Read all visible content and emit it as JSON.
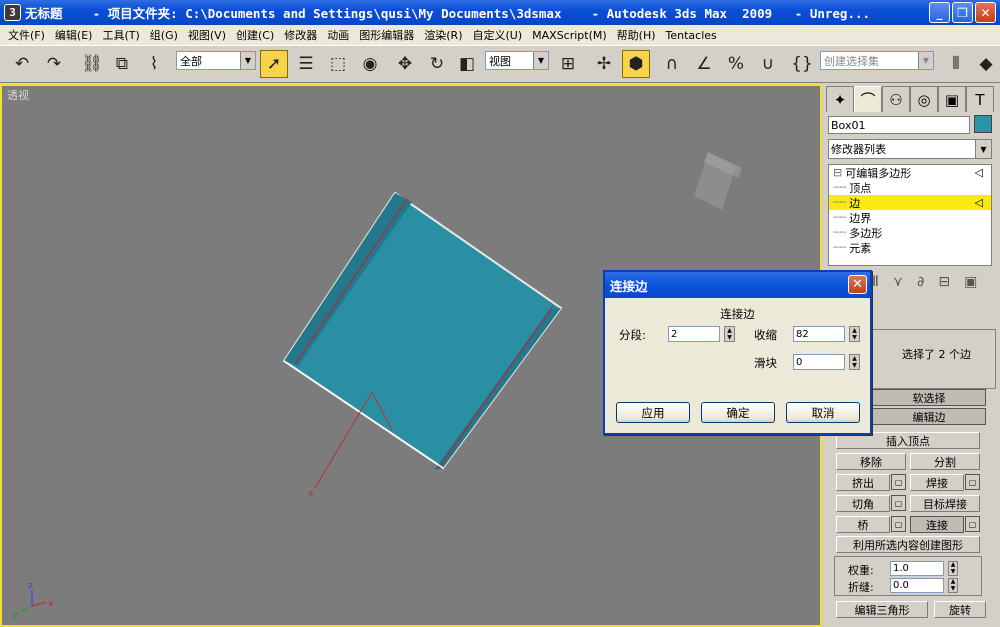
{
  "window": {
    "title": "无标题    - 项目文件夹: C:\\Documents and Settings\\qusi\\My Documents\\3dsmax    - Autodesk 3ds Max  2009   - Unreg...",
    "app_icon": "3ds-max-icon"
  },
  "menu": [
    "文件(F)",
    "编辑(E)",
    "工具(T)",
    "组(G)",
    "视图(V)",
    "创建(C)",
    "修改器",
    "动画",
    "图形编辑器",
    "渲染(R)",
    "自定义(U)",
    "MAXScript(M)",
    "帮助(H)",
    "Tentacles"
  ],
  "toolbar": {
    "selection_filter": "全部",
    "coord_system": "视图",
    "named_selection_placeholder": "创建选择集"
  },
  "viewport": {
    "label": "透视",
    "axis_labels": {
      "z": "z",
      "x": "x",
      "y": "y"
    },
    "object_color": "#2a8fa3"
  },
  "command_panel": {
    "object_name": "Box01",
    "object_color": "#2a93a8",
    "modifier_list": "修改器列表",
    "stack": {
      "root": "可编辑多边形",
      "items": [
        "顶点",
        "边",
        "边界",
        "多边形",
        "元素"
      ],
      "selected": "边"
    },
    "selection_info": "选择了 2 个边",
    "soft_select": "软选择",
    "edit_edges": "编辑边",
    "insert_vertex": "插入顶点",
    "remove": "移除",
    "split": "分割",
    "extrude": "挤出",
    "weld": "焊接",
    "chamfer": "切角",
    "target_weld": "目标焊接",
    "bridge": "桥",
    "connect": "连接",
    "create_shape": "利用所选内容创建图形",
    "weight_label": "权重:",
    "weight_value": "1.0",
    "crease_label": "折缝:",
    "crease_value": "0.0",
    "edit_tri": "编辑三角形",
    "turn": "旋转"
  },
  "dialog": {
    "title": "连接边",
    "heading": "连接边",
    "segments_label": "分段:",
    "segments_value": "2",
    "pinch_label": "收缩",
    "pinch_value": "82",
    "slide_label": "滑块",
    "slide_value": "0",
    "apply": "应用",
    "ok": "确定",
    "cancel": "取消"
  }
}
